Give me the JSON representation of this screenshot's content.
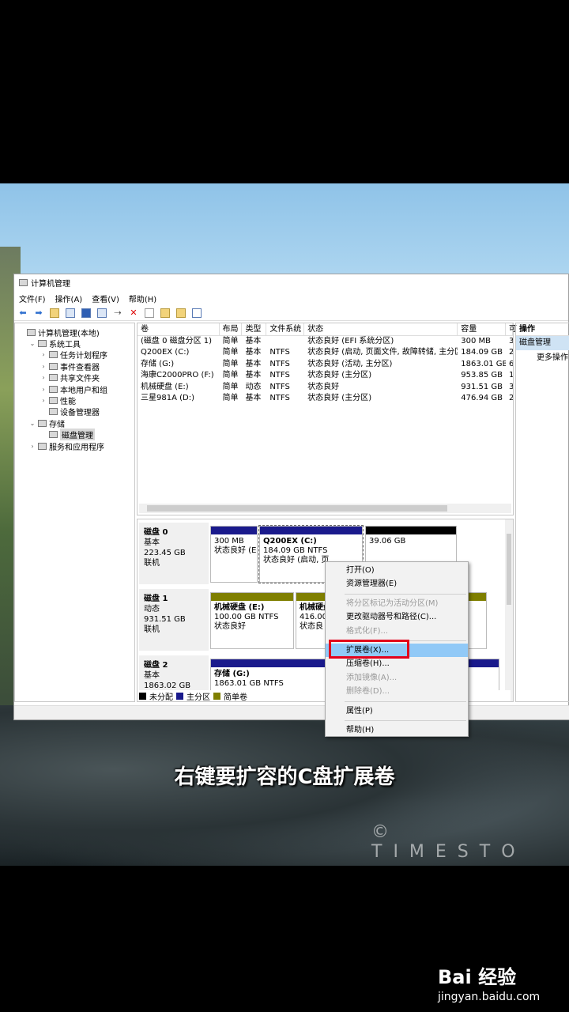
{
  "window": {
    "title": "计算机管理",
    "menus": [
      "文件(F)",
      "操作(A)",
      "查看(V)",
      "帮助(H)"
    ]
  },
  "tree": {
    "items": [
      {
        "label": "计算机管理(本地)",
        "arrow": "",
        "indent": 0
      },
      {
        "label": "系统工具",
        "arrow": "⌄",
        "indent": 1
      },
      {
        "label": "任务计划程序",
        "arrow": "›",
        "indent": 2
      },
      {
        "label": "事件查看器",
        "arrow": "›",
        "indent": 2
      },
      {
        "label": "共享文件夹",
        "arrow": "›",
        "indent": 2
      },
      {
        "label": "本地用户和组",
        "arrow": "›",
        "indent": 2
      },
      {
        "label": "性能",
        "arrow": "›",
        "indent": 2
      },
      {
        "label": "设备管理器",
        "arrow": "",
        "indent": 2
      },
      {
        "label": "存储",
        "arrow": "⌄",
        "indent": 1
      },
      {
        "label": "磁盘管理",
        "arrow": "",
        "indent": 2
      },
      {
        "label": "服务和应用程序",
        "arrow": "›",
        "indent": 1
      }
    ]
  },
  "volumes": {
    "columns": [
      "卷",
      "布局",
      "类型",
      "文件系统",
      "状态",
      "容量",
      "可"
    ],
    "rows": [
      [
        "(磁盘 0 磁盘分区 1)",
        "简单",
        "基本",
        "",
        "状态良好 (EFI 系统分区)",
        "300 MB",
        "3"
      ],
      [
        "Q200EX (C:)",
        "简单",
        "基本",
        "NTFS",
        "状态良好 (启动, 页面文件, 故障转储, 主分区)",
        "184.09 GB",
        "2"
      ],
      [
        "存储 (G:)",
        "简单",
        "基本",
        "NTFS",
        "状态良好 (活动, 主分区)",
        "1863.01 GB",
        "6"
      ],
      [
        "海康C2000PRO (F:)",
        "简单",
        "基本",
        "NTFS",
        "状态良好 (主分区)",
        "953.85 GB",
        "1"
      ],
      [
        "机械硬盘 (E:)",
        "简单",
        "动态",
        "NTFS",
        "状态良好",
        "931.51 GB",
        "3"
      ],
      [
        "三星981A (D:)",
        "简单",
        "基本",
        "NTFS",
        "状态良好 (主分区)",
        "476.94 GB",
        "2"
      ]
    ]
  },
  "disks": [
    {
      "name": "磁盘 0",
      "type": "基本",
      "size": "223.45 GB",
      "state": "联机",
      "parts": [
        {
          "title": "",
          "line1": "300 MB",
          "line2": "状态良好 (E"
        },
        {
          "title": "Q200EX  (C:)",
          "line1": "184.09 GB NTFS",
          "line2": "状态良好 (启动, 页"
        },
        {
          "title": "",
          "line1": "39.06 GB",
          "line2": ""
        }
      ]
    },
    {
      "name": "磁盘 1",
      "type": "动态",
      "size": "931.51 GB",
      "state": "联机",
      "parts": [
        {
          "title": "机械硬盘  (E:)",
          "line1": "100.00 GB NTFS",
          "line2": "状态良好"
        },
        {
          "title": "机械硬盘",
          "line1": "416.00",
          "line2": "状态良"
        }
      ]
    },
    {
      "name": "磁盘 2",
      "type": "基本",
      "size": "1863.02 GB",
      "state": "",
      "parts": [
        {
          "title": "存储  (G:)",
          "line1": "1863.01 GB NTFS",
          "line2": ""
        }
      ]
    }
  ],
  "legend": [
    "未分配",
    "主分区",
    "简单卷"
  ],
  "colors": {
    "unallocated": "#000000",
    "primary": "#1a1a8c",
    "simple": "#7f7f00",
    "highlight_border": "#e3001b"
  },
  "actions": {
    "header": "操作",
    "selected": "磁盘管理",
    "more": "更多操作"
  },
  "context_menu": {
    "group1": [
      "打开(O)",
      "资源管理器(E)"
    ],
    "group2": [
      "将分区标记为活动分区(M)",
      "更改驱动器号和路径(C)...",
      "格式化(F)..."
    ],
    "group3": [
      "扩展卷(X)...",
      "压缩卷(H)...",
      "添加镜像(A)...",
      "删除卷(D)..."
    ],
    "group4": [
      "属性(P)"
    ],
    "group5": [
      "帮助(H)"
    ]
  },
  "caption": "右键要扩容的C盘扩展卷",
  "watermark": "© TIMESTO",
  "brand": {
    "logo": "Bai 经验",
    "url": "jingyan.baidu.com"
  }
}
